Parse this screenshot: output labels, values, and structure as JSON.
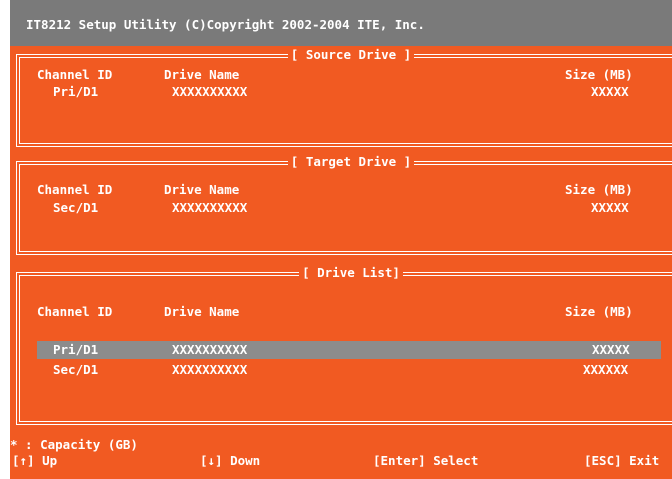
{
  "title": "IT8212 Setup Utility (C)Copyright 2002-2004 ITE, Inc.",
  "source": {
    "legend": "[ Source Drive ]",
    "headers": {
      "channel": "Channel ID",
      "name": "Drive Name",
      "size": "Size (MB)"
    },
    "row": {
      "channel": "Pri/D1",
      "name": "XXXXXXXXXX",
      "size": "XXXXX"
    }
  },
  "target": {
    "legend": "[ Target Drive ]",
    "headers": {
      "channel": "Channel ID",
      "name": "Drive Name",
      "size": "Size (MB)"
    },
    "row": {
      "channel": "Sec/D1",
      "name": "XXXXXXXXXX",
      "size": "XXXXX"
    }
  },
  "list": {
    "legend": "[ Drive List]",
    "headers": {
      "channel": "Channel ID",
      "name": "Drive Name",
      "size": "Size (MB)"
    },
    "rows": [
      {
        "channel": "Pri/D1",
        "name": "XXXXXXXXXX",
        "size": "XXXXX",
        "selected": true
      },
      {
        "channel": "Sec/D1",
        "name": "XXXXXXXXXX",
        "size": "XXXXXX",
        "selected": false
      }
    ]
  },
  "footer": {
    "note": "* : Capacity (GB)",
    "up": "[↑] Up",
    "down": "[↓] Down",
    "select": "[Enter] Select",
    "exit": "[ESC] Exit"
  },
  "colors": {
    "background": "#f15a22",
    "titlebar": "#7a7a7a",
    "selection": "#8c8c8c"
  }
}
